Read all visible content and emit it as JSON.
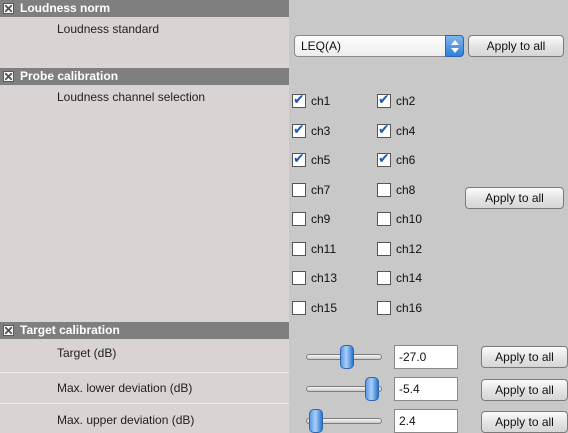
{
  "sections": {
    "loudness_norm": {
      "title": "Loudness norm"
    },
    "probe_calibration": {
      "title": "Probe calibration"
    },
    "target_calibration": {
      "title": "Target calibration"
    }
  },
  "loudness_standard": {
    "label": "Loudness standard",
    "value": "LEQ(A)",
    "apply_label": "Apply to all"
  },
  "channel_selection": {
    "label": "Loudness channel selection",
    "apply_label": "Apply to all",
    "channels": [
      {
        "label": "ch1",
        "checked": true
      },
      {
        "label": "ch2",
        "checked": true
      },
      {
        "label": "ch3",
        "checked": true
      },
      {
        "label": "ch4",
        "checked": true
      },
      {
        "label": "ch5",
        "checked": true
      },
      {
        "label": "ch6",
        "checked": true
      },
      {
        "label": "ch7",
        "checked": false
      },
      {
        "label": "ch8",
        "checked": false
      },
      {
        "label": "ch9",
        "checked": false
      },
      {
        "label": "ch10",
        "checked": false
      },
      {
        "label": "ch11",
        "checked": false
      },
      {
        "label": "ch12",
        "checked": false
      },
      {
        "label": "ch13",
        "checked": false
      },
      {
        "label": "ch14",
        "checked": false
      },
      {
        "label": "ch15",
        "checked": false
      },
      {
        "label": "ch16",
        "checked": false
      }
    ]
  },
  "target": {
    "label": "Target (dB)",
    "value": "-27.0",
    "slider_level": 0.55,
    "apply_label": "Apply to all"
  },
  "max_lower": {
    "label": "Max. lower deviation (dB)",
    "value": "-5.4",
    "slider_level": 0.95,
    "apply_label": "Apply to all"
  },
  "max_upper": {
    "label": "Max. upper deviation (dB)",
    "value": "2.4",
    "slider_level": 0.05,
    "apply_label": "Apply to all"
  },
  "colors": {
    "header_bg": "#7f7f7f",
    "label_pane_bg": "#d9d3d3",
    "control_pane_bg": "#c8c8c8",
    "accent_blue": "#2f7fd9"
  }
}
